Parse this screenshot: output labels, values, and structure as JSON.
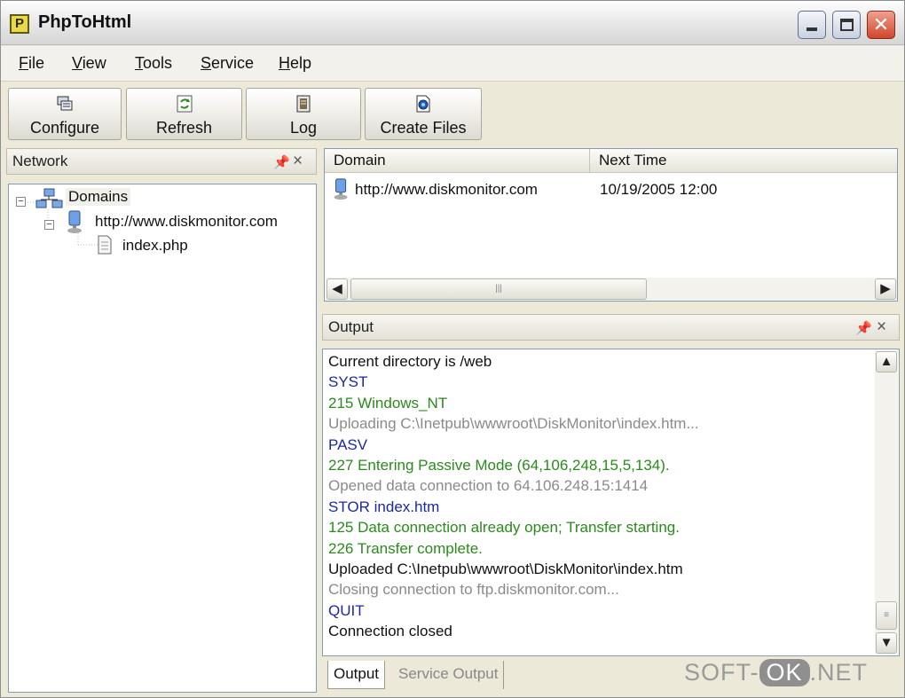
{
  "window": {
    "title": "PhpToHtml",
    "app_icon_letter": "P",
    "controls": {
      "close_glyph": "✕"
    }
  },
  "menu": [
    "File",
    "View",
    "Tools",
    "Service",
    "Help"
  ],
  "toolbar": [
    {
      "label": "Configure",
      "icon": "configure-icon"
    },
    {
      "label": "Refresh",
      "icon": "refresh-icon"
    },
    {
      "label": "Log",
      "icon": "log-icon"
    },
    {
      "label": "Create Files",
      "icon": "create-files-icon"
    }
  ],
  "network_panel": {
    "title": "Network",
    "tree": {
      "root": "Domains",
      "domain": "http://www.diskmonitor.com",
      "file": "index.php"
    }
  },
  "domains_grid": {
    "columns": [
      "Domain",
      "Next Time"
    ],
    "rows": [
      {
        "domain": "http://www.diskmonitor.com",
        "next_time": "10/19/2005 12:00"
      }
    ]
  },
  "output_panel": {
    "title": "Output",
    "lines": [
      {
        "text": "Current directory is /web",
        "color": "#111111"
      },
      {
        "text": "SYST",
        "color": "#1c2a9e"
      },
      {
        "text": "215 Windows_NT",
        "color": "#2a8a1c"
      },
      {
        "text": "Uploading C:\\Inetpub\\wwwroot\\DiskMonitor\\index.htm...",
        "color": "#8a8a8a"
      },
      {
        "text": "PASV",
        "color": "#1c2a9e"
      },
      {
        "text": "227 Entering Passive Mode (64,106,248,15,5,134).",
        "color": "#2a8a1c"
      },
      {
        "text": "Opened data connection to 64.106.248.15:1414",
        "color": "#8a8a8a"
      },
      {
        "text": "STOR index.htm",
        "color": "#1c2a9e"
      },
      {
        "text": "125 Data connection already open; Transfer starting.",
        "color": "#2a8a1c"
      },
      {
        "text": "226 Transfer complete.",
        "color": "#2a8a1c"
      },
      {
        "text": "Uploaded  C:\\Inetpub\\wwwroot\\DiskMonitor\\index.htm",
        "color": "#111111"
      },
      {
        "text": "Closing connection to ftp.diskmonitor.com...",
        "color": "#8a8a8a"
      },
      {
        "text": "QUIT",
        "color": "#1c2a9e"
      },
      {
        "text": "Connection closed",
        "color": "#111111"
      }
    ],
    "tabs": [
      "Output",
      "Service Output"
    ]
  },
  "watermark": {
    "left": "SOFT-",
    "mid": "OK",
    "right": ".NET"
  }
}
